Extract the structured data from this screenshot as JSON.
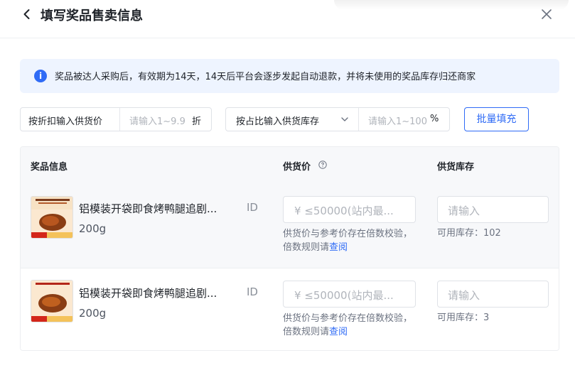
{
  "header": {
    "title": "填写奖品售卖信息"
  },
  "notice": {
    "text": "奖品被达人采购后，有效期为14天，14天后平台会逐步发起自动退款，并将未使用的奖品库存归还商家"
  },
  "controls": {
    "discount_label": "按折扣输入供货价",
    "discount_placeholder": "请输入1~9.9",
    "discount_unit": "折",
    "ratio_label": "按占比输入供货库存",
    "ratio_placeholder": "请输入1~100",
    "ratio_unit": "%",
    "batch_label": "批量填充"
  },
  "table": {
    "headers": {
      "product": "奖品信息",
      "price": "供货价",
      "stock": "供货库存"
    },
    "rows": [
      {
        "name": "铝模装开袋即食烤鸭腿追剧...",
        "id_label": "ID",
        "spec": "200g",
        "price_placeholder": "¥ ≤50000(站内最...",
        "tip_text": "供货价与参考价存在倍数校验，倍数规则请",
        "tip_link": "查阅",
        "stock_placeholder": "请输入",
        "available": "可用库存：102"
      },
      {
        "name": "铝模装开袋即食烤鸭腿追剧...",
        "id_label": "ID",
        "spec": "200g",
        "price_placeholder": "¥ ≤50000(站内最...",
        "tip_text": "供货价与参考价存在倍数校验，倍数规则请",
        "tip_link": "查阅",
        "stock_placeholder": "请输入",
        "available": "可用库存：3"
      }
    ]
  },
  "colors": {
    "accent": "#2f6bf6",
    "notice_bg": "#eef4ff",
    "header_bg": "#f7f8fa"
  }
}
